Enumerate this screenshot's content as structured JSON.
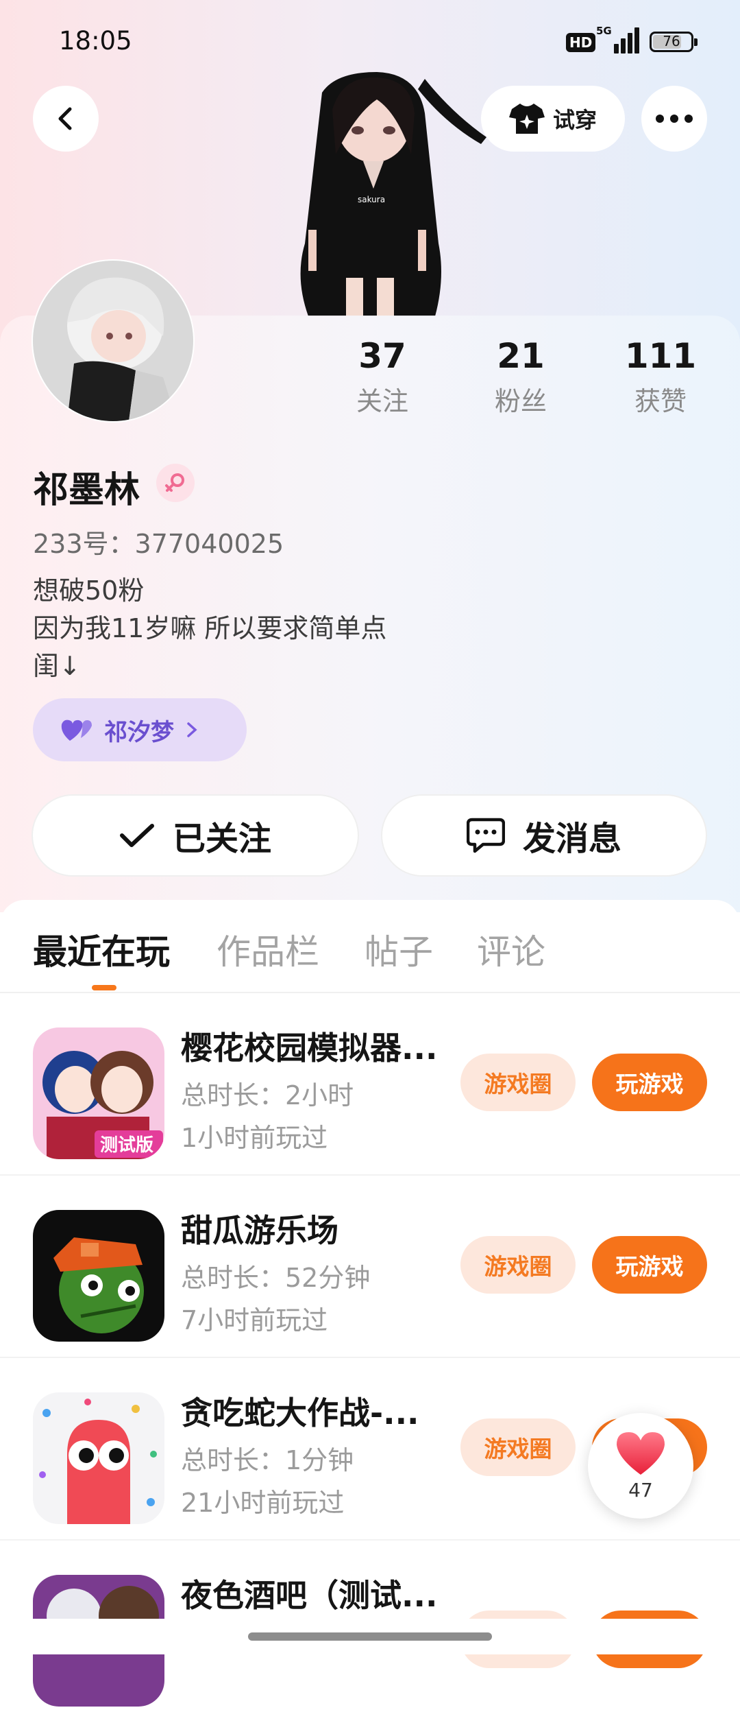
{
  "status_bar": {
    "time": "18:05",
    "hd": "HD",
    "network": "5G",
    "battery": "76"
  },
  "header": {
    "try_on_label": "试穿"
  },
  "profile": {
    "stats": [
      {
        "value": "37",
        "label": "关注"
      },
      {
        "value": "21",
        "label": "粉丝"
      },
      {
        "value": "111",
        "label": "获赞"
      }
    ],
    "name": "祁墨林",
    "uid": "233号：377040025",
    "bio": [
      "想破50粉",
      "因为我11岁嘛  所以要求简单点",
      "闺↓"
    ],
    "couple_name": "祁汐梦",
    "follow_label": "已关注",
    "message_label": "发消息"
  },
  "tabs": [
    {
      "label": "最近在玩",
      "active": true
    },
    {
      "label": "作品栏",
      "active": false
    },
    {
      "label": "帖子",
      "active": false
    },
    {
      "label": "评论",
      "active": false
    }
  ],
  "games": [
    {
      "name": "樱花校园模拟器...",
      "duration": "总时长：2小时",
      "last_played": "1小时前玩过",
      "circle_label": "游戏圈",
      "play_label": "玩游戏",
      "icon": "sakura-school-icon"
    },
    {
      "name": "甜瓜游乐场",
      "duration": "总时长：52分钟",
      "last_played": "7小时前玩过",
      "circle_label": "游戏圈",
      "play_label": "玩游戏",
      "icon": "melon-playground-icon"
    },
    {
      "name": "贪吃蛇大作战-...",
      "duration": "总时长：1分钟",
      "last_played": "21小时前玩过",
      "circle_label": "游戏圈",
      "play_label": "玩游戏",
      "icon": "snake-game-icon"
    },
    {
      "name": "夜色酒吧（测试...",
      "duration": "",
      "last_played": "",
      "circle_label": "",
      "play_label": "",
      "icon": "night-bar-icon"
    }
  ],
  "floating_like": {
    "count": "47",
    "icon": "heart-icon"
  },
  "colors": {
    "accent": "#f6731a",
    "accent_light": "#fde7dc",
    "couple_bg": "#e6dbf8",
    "couple_text": "#6a4fcf"
  }
}
